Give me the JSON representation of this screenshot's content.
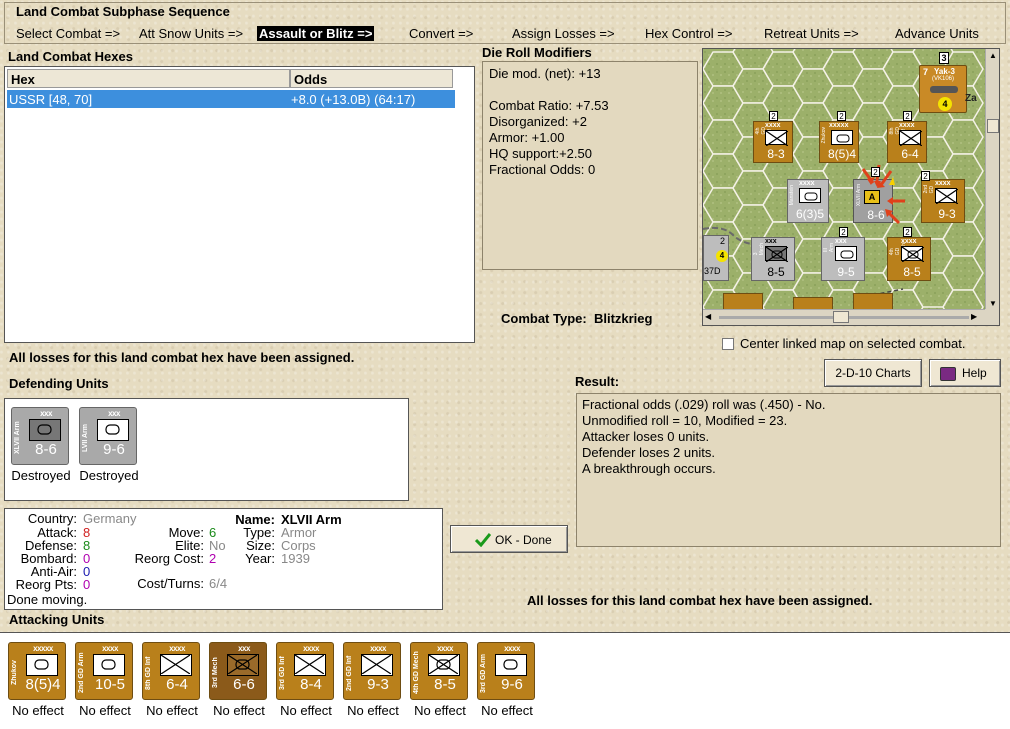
{
  "sequence": {
    "title": "Land Combat Subphase Sequence",
    "steps": [
      "Select Combat =>",
      "Att Snow Units =>",
      "Assault or Blitz =>",
      "Convert =>",
      "Assign Losses =>",
      "Hex Control =>",
      "Retreat Units =>",
      "Advance Units"
    ],
    "active_index": 2
  },
  "hexes": {
    "label": "Land Combat Hexes",
    "col_hex": "Hex",
    "col_odds": "Odds",
    "rows": [
      {
        "hex": "USSR [48, 70]",
        "odds": "+8.0 (+13.0B) (64:17)"
      }
    ]
  },
  "drm": {
    "label": "Die Roll Modifiers",
    "lines": [
      "Die mod. (net): +13",
      "",
      "Combat Ratio: +7.53",
      "Disorganized: +2",
      "Armor: +1.00",
      "HQ support:+2.50",
      "Fractional Odds: 0"
    ]
  },
  "combat_type": {
    "label": "Combat Type:",
    "value": "Blitzkrieg"
  },
  "losses_note": "All losses for this land combat hex have been assigned.",
  "center_check_label": "Center linked map on selected combat.",
  "buttons": {
    "charts": "2-D-10 Charts",
    "help": "Help",
    "ok": "OK - Done"
  },
  "result": {
    "label": "Result:",
    "lines": [
      "Fractional odds (.029) roll was (.450)  - No.",
      "Unmodified roll = 10, Modified = 23.",
      "Attacker loses 0 units.",
      "Defender loses 2 units.",
      "A breakthrough occurs."
    ]
  },
  "defending": {
    "label": "Defending Units",
    "units": [
      {
        "side": "XLVII Arm",
        "size": "xxx",
        "strength": "8-6",
        "status": "Destroyed"
      },
      {
        "side": "LVII Arm",
        "size": "xxx",
        "strength": "9-6",
        "status": "Destroyed"
      }
    ]
  },
  "info": {
    "country_k": "Country:",
    "country_v": "Germany",
    "attack_k": "Attack:",
    "attack_v": "8",
    "defense_k": "Defense:",
    "defense_v": "8",
    "bombard_k": "Bombard:",
    "bombard_v": "0",
    "antiair_k": "Anti-Air:",
    "antiair_v": "0",
    "reorgpts_k": "Reorg Pts:",
    "reorgpts_v": "0",
    "move_k": "Move:",
    "move_v": "6",
    "elite_k": "Elite:",
    "elite_v": "No",
    "reorgcost_k": "Reorg Cost:",
    "reorgcost_v": "2",
    "costturns_k": "Cost/Turns:",
    "costturns_v": "6/4",
    "name_k": "Name:",
    "name_v": "XLVII Arm",
    "type_k": "Type:",
    "type_v": "Armor",
    "size_k": "Size:",
    "size_v": "Corps",
    "year_k": "Year:",
    "year_v": "1939",
    "status": "Done moving.",
    "colors": {
      "attack": "#d02020",
      "defense": "#1a8a1a",
      "bombard": "#b000b0",
      "antiair": "#1a1ab0",
      "grey": "#888888",
      "move": "#1a8a1a",
      "reorgcost": "#b000b0"
    }
  },
  "attacking": {
    "label": "Attacking Units",
    "units": [
      {
        "side": "Zhukov",
        "size": "xxxxx",
        "strength": "8(5)4",
        "status": "No effect",
        "sym": "hq"
      },
      {
        "side": "2nd GD Arm",
        "size": "xxxx",
        "strength": "10-5",
        "status": "No effect",
        "sym": "arm"
      },
      {
        "side": "8th GD Inf",
        "size": "xxxx",
        "strength": "6-4",
        "status": "No effect",
        "sym": "inf"
      },
      {
        "side": "3rd Mech",
        "size": "xxx",
        "strength": "6-6",
        "status": "No effect",
        "sym": "mech"
      },
      {
        "side": "3rd GD Inf",
        "size": "xxxx",
        "strength": "8-4",
        "status": "No effect",
        "sym": "inf"
      },
      {
        "side": "2nd GD Inf",
        "size": "xxxx",
        "strength": "9-3",
        "status": "No effect",
        "sym": "inf"
      },
      {
        "side": "4th GD Mech",
        "size": "xxxx",
        "strength": "8-5",
        "status": "No effect",
        "sym": "mech"
      },
      {
        "side": "3rd GD Arm",
        "size": "xxxx",
        "strength": "9-6",
        "status": "No effect",
        "sym": "arm"
      }
    ]
  },
  "map": {
    "counters": [
      {
        "label": "8-3",
        "size": "xxxx",
        "side": "4th GD Inf"
      },
      {
        "label": "8(5)4",
        "size": "xxxxx",
        "side": "Zhukov"
      },
      {
        "label": "6-4",
        "size": "xxxx",
        "side": "8th GD Inf"
      },
      {
        "label": "6(3)5",
        "size": "xxxx",
        "side": "Manstein"
      },
      {
        "label": "9-3",
        "size": "xxxx",
        "side": "2nd GD Inf"
      },
      {
        "label": "8-5",
        "size": "xxx",
        "side": "3 Mech"
      },
      {
        "label": "9-5",
        "size": "xxx",
        "side": "III Arm"
      },
      {
        "label": "8-5",
        "size": "xxxx",
        "side": "4th GD Mech"
      },
      {
        "label": "8-6",
        "size": "",
        "side": "XLVII Arm"
      }
    ],
    "aircraft": {
      "name": "Yak-3",
      "model": "(VK106)",
      "strength": "7",
      "range": "4"
    },
    "stack_counts": [
      "3",
      "2",
      "2",
      "2",
      "2",
      "2",
      "2",
      "2"
    ],
    "place_fragment": "Za",
    "stray": [
      "2",
      "4",
      "37D"
    ],
    "strike": "A"
  }
}
